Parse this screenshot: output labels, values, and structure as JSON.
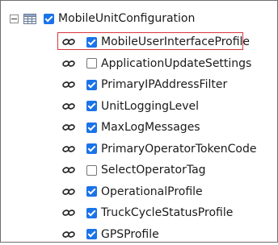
{
  "tree": {
    "root": {
      "label": "MobileUnitConfiguration",
      "checked": true,
      "expanded": true,
      "icons": [
        "collapse-icon",
        "table-icon"
      ]
    },
    "children": [
      {
        "label": "MobileUserInterfaceProfile",
        "checked": true,
        "selected": true,
        "icon": "link-icon"
      },
      {
        "label": "ApplicationUpdateSettings",
        "checked": false,
        "icon": "link-icon"
      },
      {
        "label": "PrimaryIPAddressFilter",
        "checked": true,
        "icon": "link-icon"
      },
      {
        "label": "UnitLoggingLevel",
        "checked": true,
        "icon": "link-icon"
      },
      {
        "label": "MaxLogMessages",
        "checked": true,
        "icon": "link-icon"
      },
      {
        "label": "PrimaryOperatorTokenCode",
        "checked": true,
        "icon": "link-icon"
      },
      {
        "label": "SelectOperatorTag",
        "checked": false,
        "icon": "link-icon"
      },
      {
        "label": "OperationalProfile",
        "checked": true,
        "icon": "link-icon"
      },
      {
        "label": "TruckCycleStatusProfile",
        "checked": true,
        "icon": "link-icon"
      },
      {
        "label": "GPSProfile",
        "checked": true,
        "icon": "link-icon"
      }
    ]
  },
  "colors": {
    "checkbox_checked": "#1a73e8",
    "selection_border": "#d9363e"
  }
}
